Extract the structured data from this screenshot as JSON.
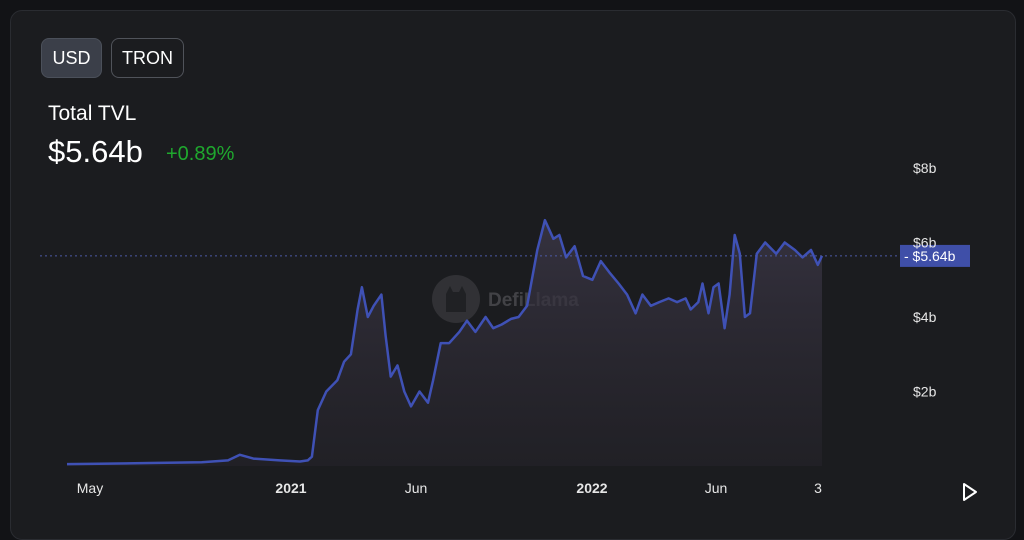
{
  "currency_toggle": {
    "usd_label": "USD",
    "tron_label": "TRON"
  },
  "summary": {
    "label": "Total TVL",
    "value": "$5.64b",
    "change": "+0.89%"
  },
  "watermark": "DefiLlama",
  "colors": {
    "line": "#3f51b5",
    "change_positive": "#1fa82e",
    "current_value_badge": "#3f4fa8"
  },
  "chart_data": {
    "type": "area",
    "title": "",
    "xlabel": "",
    "ylabel": "",
    "x_ticks": [
      "May",
      "2021",
      "Jun",
      "2022",
      "Jun",
      "3"
    ],
    "y_ticks": [
      "$2b",
      "$4b",
      "$6b",
      "$8b"
    ],
    "ylim": [
      0,
      8
    ],
    "grid": false,
    "current_value_marker": {
      "label": "$5.64b",
      "value": 5.64
    },
    "series": [
      {
        "values_unit": "billions USD",
        "x": [
          "2020-04-25",
          "2020-06-01",
          "2020-08-01",
          "2020-10-01",
          "2020-11-01",
          "2020-11-15",
          "2020-12-01",
          "2021-01-01",
          "2021-01-25",
          "2021-02-03",
          "2021-02-08",
          "2021-02-15",
          "2021-02-25",
          "2021-03-10",
          "2021-03-18",
          "2021-03-26",
          "2021-04-03",
          "2021-04-08",
          "2021-04-15",
          "2021-04-22",
          "2021-05-01",
          "2021-05-06",
          "2021-05-12",
          "2021-05-20",
          "2021-05-28",
          "2021-06-05",
          "2021-06-15",
          "2021-06-25",
          "2021-07-01",
          "2021-07-10",
          "2021-07-20",
          "2021-08-01",
          "2021-08-10",
          "2021-08-20",
          "2021-09-01",
          "2021-09-10",
          "2021-09-20",
          "2021-10-01",
          "2021-10-10",
          "2021-10-20",
          "2021-11-01",
          "2021-11-10",
          "2021-11-20",
          "2021-11-27",
          "2021-12-05",
          "2021-12-15",
          "2021-12-25",
          "2022-01-05",
          "2022-01-15",
          "2022-01-25",
          "2022-02-05",
          "2022-02-15",
          "2022-02-25",
          "2022-03-05",
          "2022-03-15",
          "2022-03-25",
          "2022-04-05",
          "2022-04-15",
          "2022-04-25",
          "2022-05-01",
          "2022-05-10",
          "2022-05-15",
          "2022-05-22",
          "2022-05-28",
          "2022-06-03",
          "2022-06-10",
          "2022-06-16",
          "2022-06-22",
          "2022-06-28",
          "2022-07-04",
          "2022-07-10",
          "2022-07-18",
          "2022-07-28",
          "2022-08-10",
          "2022-08-20",
          "2022-09-01",
          "2022-09-10",
          "2022-09-20",
          "2022-09-28",
          "2022-10-03"
        ],
        "values": [
          0.05,
          0.06,
          0.08,
          0.1,
          0.15,
          0.3,
          0.2,
          0.15,
          0.12,
          0.15,
          0.25,
          1.5,
          2.0,
          2.3,
          2.8,
          3.0,
          4.2,
          4.8,
          4.0,
          4.3,
          4.6,
          3.5,
          2.4,
          2.7,
          2.0,
          1.6,
          2.0,
          1.7,
          2.3,
          3.3,
          3.3,
          3.6,
          3.9,
          3.6,
          4.0,
          3.7,
          3.8,
          3.95,
          4.0,
          4.3,
          5.8,
          6.6,
          6.1,
          6.2,
          5.6,
          5.9,
          5.1,
          5.0,
          5.5,
          5.2,
          4.9,
          4.6,
          4.1,
          4.6,
          4.3,
          4.4,
          4.5,
          4.4,
          4.5,
          4.2,
          4.4,
          4.9,
          4.1,
          4.8,
          4.9,
          3.7,
          4.6,
          6.2,
          5.7,
          4.0,
          4.1,
          5.7,
          6.0,
          5.7,
          6.0,
          5.8,
          5.6,
          5.8,
          5.4,
          5.64
        ]
      }
    ]
  }
}
